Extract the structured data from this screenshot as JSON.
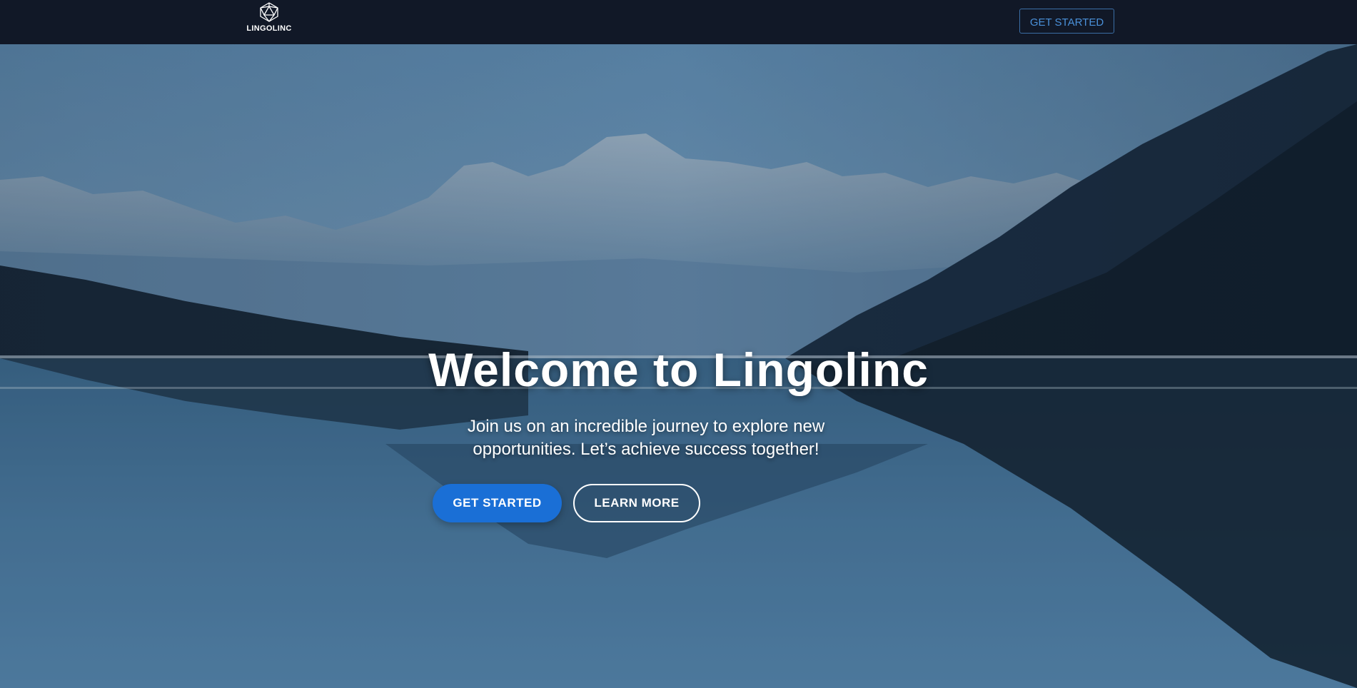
{
  "header": {
    "logo_text": "LINGOLINC",
    "logo_icon": "icosahedron-icon",
    "cta_label": "GET STARTED"
  },
  "hero": {
    "background": "mountain-lake-reflection-photo",
    "title": "Welcome to Lingolinc",
    "subtitle": "Join us on an incredible journey to explore new opportunities. Let’s achieve success together!",
    "primary_button": "GET STARTED",
    "secondary_button": "LEARN MORE"
  },
  "colors": {
    "header_bg": "#111827",
    "accent": "#1a6fd6",
    "nav_cta_text": "#4a90d9",
    "text": "#ffffff"
  }
}
